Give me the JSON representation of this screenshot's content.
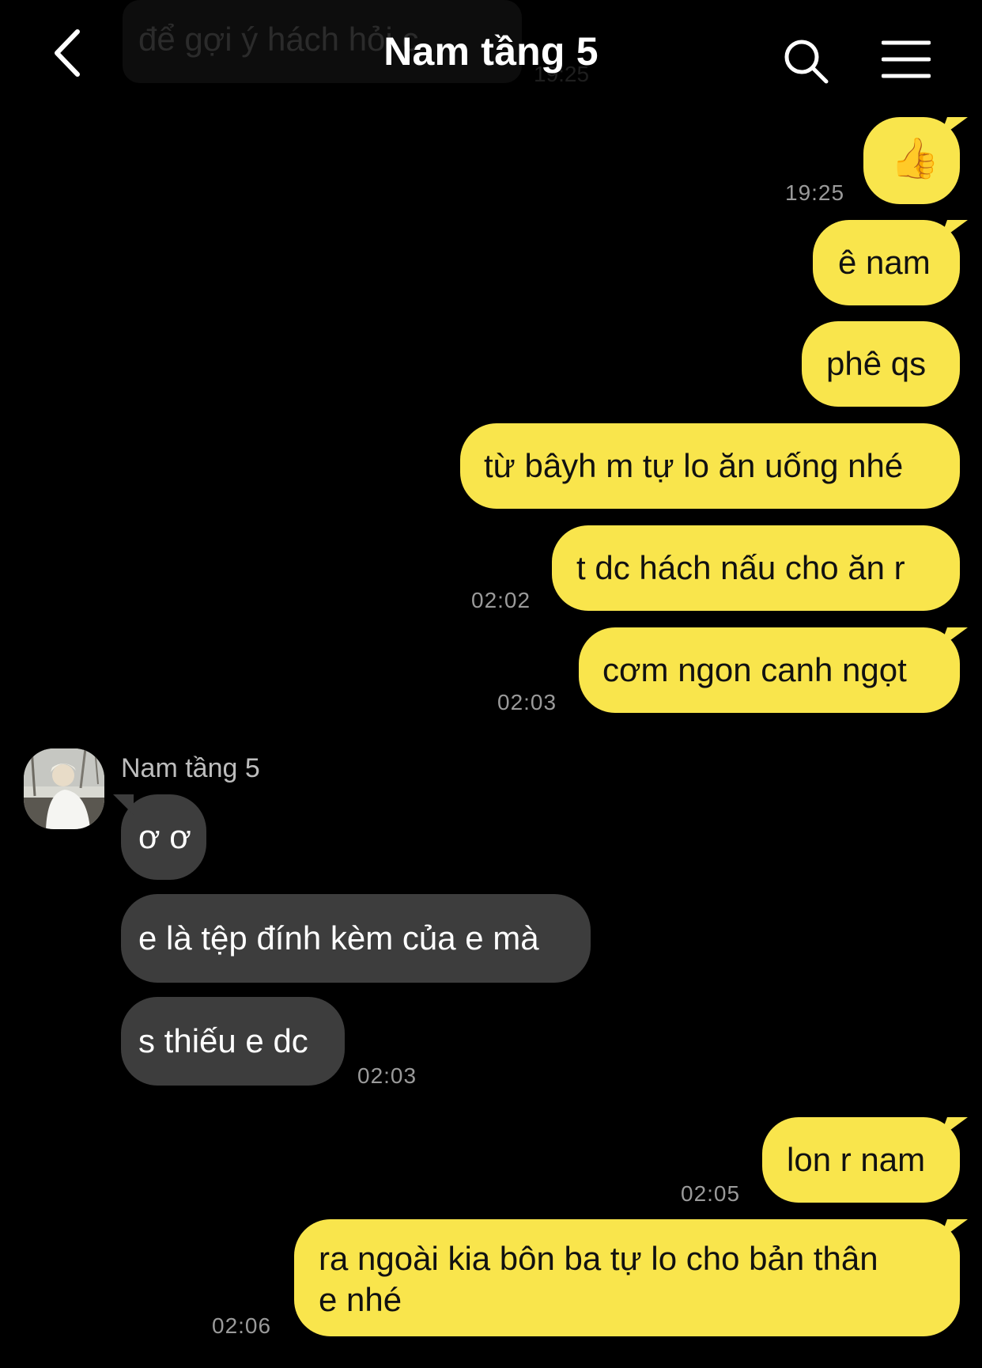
{
  "header": {
    "title": "Nam tầng 5",
    "faded_preview_text": "để gợi ý hách hỏi c",
    "faded_preview_time": "19:25"
  },
  "messages": [
    {
      "text": "👍",
      "time": "19:25",
      "from": "me"
    },
    {
      "text": "ê nam",
      "from": "me"
    },
    {
      "text": "phê qs",
      "from": "me"
    },
    {
      "text": "từ bâyh m tự lo ăn uống nhé",
      "from": "me"
    },
    {
      "text": "t dc hách nấu cho ăn r",
      "time": "02:02",
      "from": "me"
    },
    {
      "text": "cơm ngon canh ngọt",
      "time": "02:03",
      "from": "me"
    },
    {
      "text": "ơ ơ",
      "from": "Nam tầng 5"
    },
    {
      "text": "e là tệp đính kèm của e mà",
      "from": "Nam tầng 5"
    },
    {
      "text": "s thiếu e dc",
      "time": "02:03",
      "from": "Nam tầng 5"
    },
    {
      "text": "lon r nam",
      "time": "02:05",
      "from": "me"
    },
    {
      "text_line1": "ra ngoài kia bôn ba tự lo cho bản thân",
      "text_line2": "e nhé",
      "time": "02:06",
      "from": "me"
    }
  ],
  "sender_name": "Nam tầng 5",
  "colors": {
    "mine_bubble": "#f9e54c",
    "their_bubble": "#3d3d3d",
    "background": "#000000"
  },
  "icons": {
    "back": "chevron-left-icon",
    "search": "search-icon",
    "menu": "hamburger-menu-icon"
  }
}
